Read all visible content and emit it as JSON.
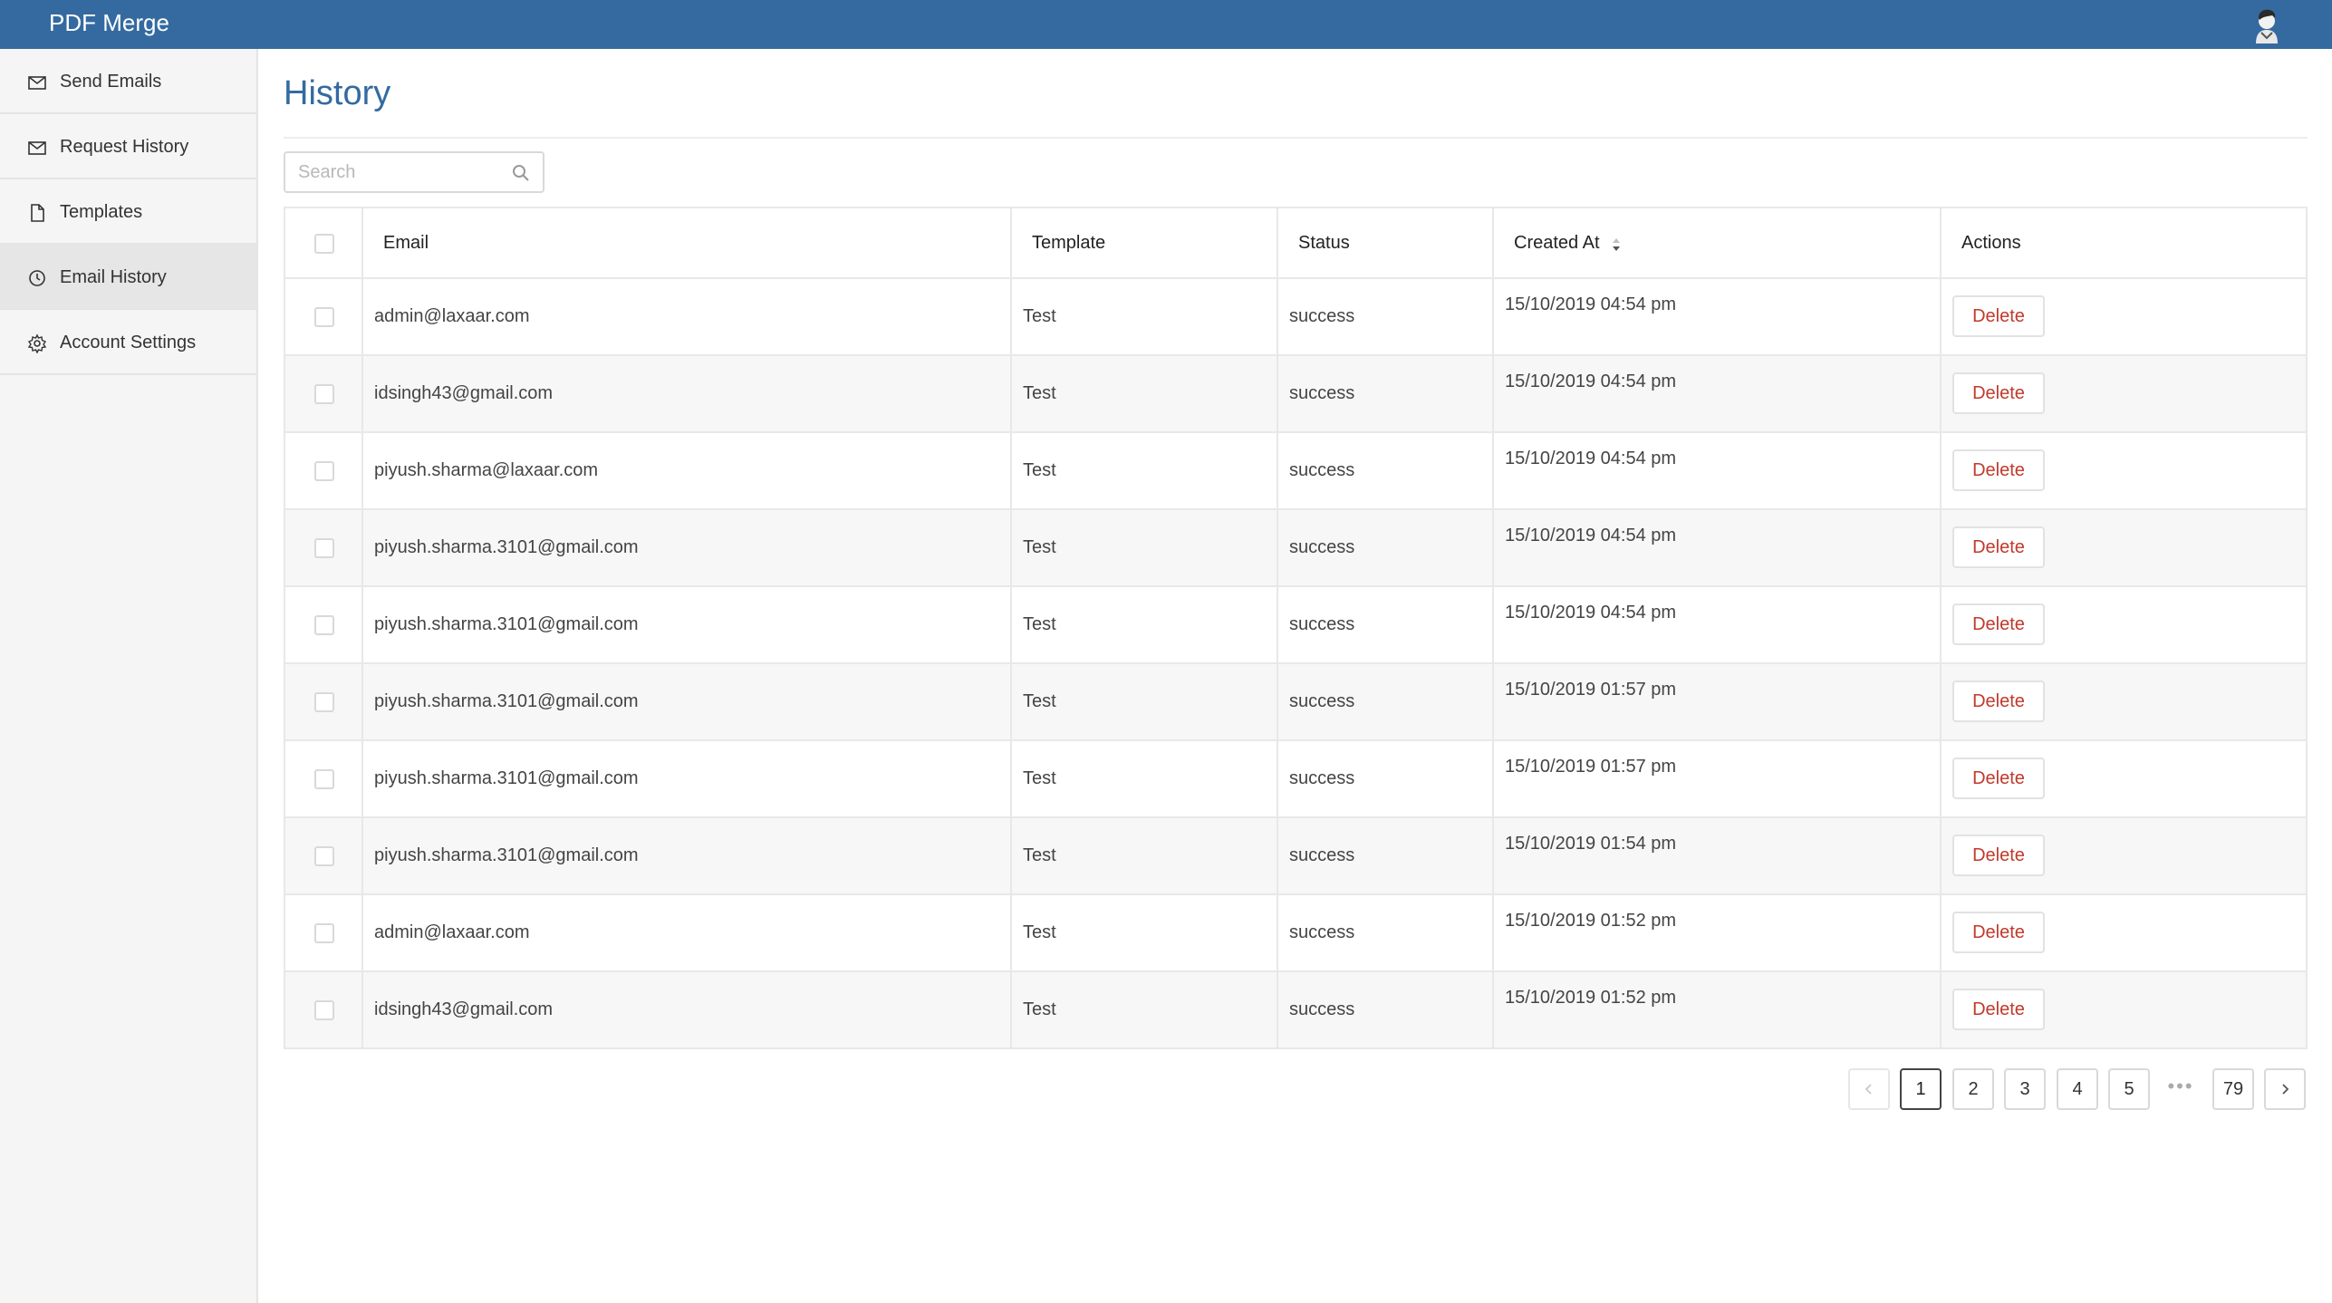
{
  "app": {
    "title": "PDF Merge"
  },
  "sidebar": {
    "items": [
      {
        "label": "Send Emails",
        "icon": "mail-icon"
      },
      {
        "label": "Request History",
        "icon": "mail-icon"
      },
      {
        "label": "Templates",
        "icon": "file-icon"
      },
      {
        "label": "Email History",
        "icon": "clock-icon",
        "active": true
      },
      {
        "label": "Account Settings",
        "icon": "gear-icon"
      }
    ]
  },
  "page": {
    "title": "History"
  },
  "search": {
    "placeholder": "Search",
    "value": ""
  },
  "table": {
    "headers": {
      "email": "Email",
      "template": "Template",
      "status": "Status",
      "created_at": "Created At",
      "actions": "Actions"
    },
    "delete_label": "Delete",
    "rows": [
      {
        "email": "admin@laxaar.com",
        "template": "Test",
        "status": "success",
        "created_at": "15/10/2019 04:54 pm"
      },
      {
        "email": "idsingh43@gmail.com",
        "template": "Test",
        "status": "success",
        "created_at": "15/10/2019 04:54 pm"
      },
      {
        "email": "piyush.sharma@laxaar.com",
        "template": "Test",
        "status": "success",
        "created_at": "15/10/2019 04:54 pm"
      },
      {
        "email": "piyush.sharma.3101@gmail.com",
        "template": "Test",
        "status": "success",
        "created_at": "15/10/2019 04:54 pm"
      },
      {
        "email": "piyush.sharma.3101@gmail.com",
        "template": "Test",
        "status": "success",
        "created_at": "15/10/2019 04:54 pm"
      },
      {
        "email": "piyush.sharma.3101@gmail.com",
        "template": "Test",
        "status": "success",
        "created_at": "15/10/2019 01:57 pm"
      },
      {
        "email": "piyush.sharma.3101@gmail.com",
        "template": "Test",
        "status": "success",
        "created_at": "15/10/2019 01:57 pm"
      },
      {
        "email": "piyush.sharma.3101@gmail.com",
        "template": "Test",
        "status": "success",
        "created_at": "15/10/2019 01:54 pm"
      },
      {
        "email": "admin@laxaar.com",
        "template": "Test",
        "status": "success",
        "created_at": "15/10/2019 01:52 pm"
      },
      {
        "email": "idsingh43@gmail.com",
        "template": "Test",
        "status": "success",
        "created_at": "15/10/2019 01:52 pm"
      }
    ]
  },
  "pagination": {
    "pages": [
      "1",
      "2",
      "3",
      "4",
      "5"
    ],
    "current": "1",
    "ellipsis": "•••",
    "last": "79"
  },
  "colors": {
    "header_bar": "#346aa0",
    "title": "#346aa0",
    "delete_text": "#c0392b"
  }
}
